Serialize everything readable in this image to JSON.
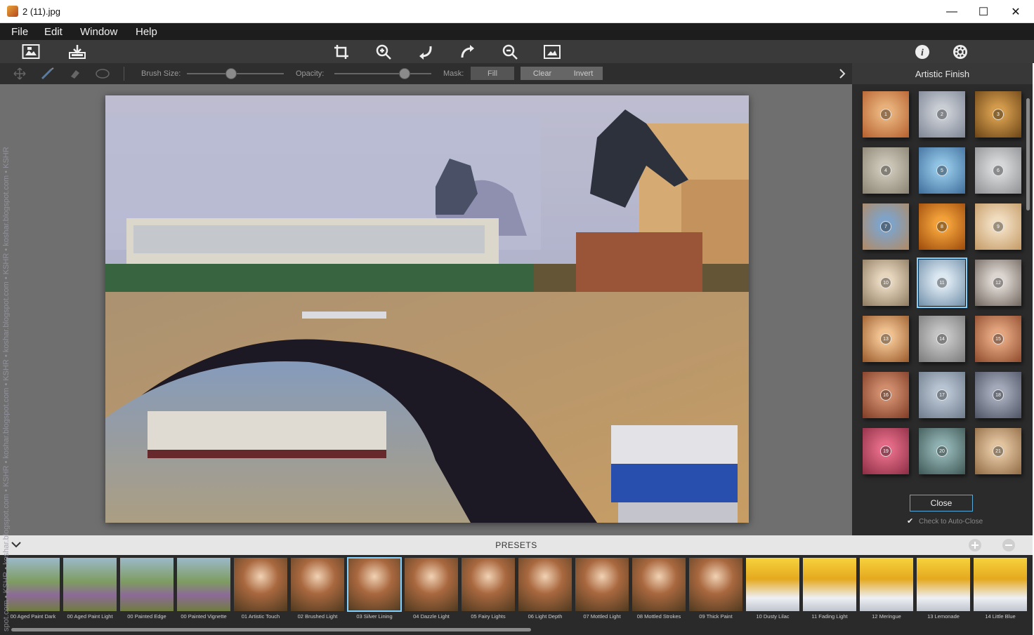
{
  "window": {
    "title": "2 (11).jpg",
    "minimize": "—",
    "maximize": "☐",
    "close": "✕"
  },
  "menu": [
    "File",
    "Edit",
    "Window",
    "Help"
  ],
  "options": {
    "brush_size_label": "Brush Size:",
    "opacity_label": "Opacity:",
    "mask_label": "Mask:",
    "fill": "Fill",
    "clear": "Clear",
    "invert": "Invert",
    "brush_size_value": 0.45,
    "opacity_value": 0.72
  },
  "panel": {
    "title": "Artistic Finish",
    "textures": [
      "1",
      "2",
      "3",
      "4",
      "5",
      "6",
      "7",
      "8",
      "9",
      "10",
      "11",
      "12",
      "13",
      "14",
      "15",
      "16",
      "17",
      "18",
      "19",
      "20",
      "21"
    ],
    "selected": "11",
    "close_label": "Close",
    "auto_close_label": "Check to Auto-Close",
    "auto_close_checked": true
  },
  "presets": {
    "title": "PRESETS",
    "items": [
      {
        "label": "00 Aged Paint Dark"
      },
      {
        "label": "00 Aged Paint Light"
      },
      {
        "label": "00 Painted Edge"
      },
      {
        "label": "00 Painted Vignette"
      },
      {
        "label": "01 Artistic Touch"
      },
      {
        "label": "02 Brushed Light"
      },
      {
        "label": "03 Silver Lining"
      },
      {
        "label": "04 Dazzle Light"
      },
      {
        "label": "05 Fairy Lights"
      },
      {
        "label": "06 Light Depth"
      },
      {
        "label": "07 Mottled Light"
      },
      {
        "label": "08 Mottled Strokes"
      },
      {
        "label": "09 Thick Paint"
      },
      {
        "label": "10 Dusty Lilac"
      },
      {
        "label": "11 Fading Light"
      },
      {
        "label": "12 Meringue"
      },
      {
        "label": "13 Lemonade"
      },
      {
        "label": "14 Little Blue"
      }
    ],
    "selected": "03 Silver Lining"
  },
  "watermark": "spot.com • KSHR • koshar.blogspot.com • KSHR • koshar.blogspot.com • KSHR • koshar.blogspot.com • KSHR • koshar.blogspot.com • KSHR"
}
